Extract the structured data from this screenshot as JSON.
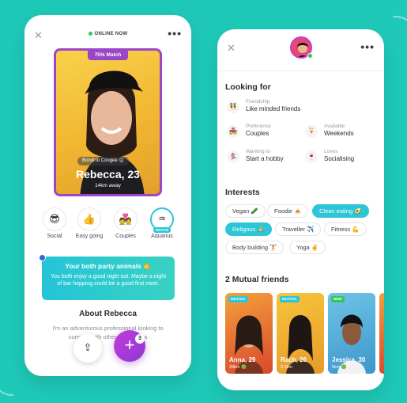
{
  "left_phone": {
    "status": "ONLINE NOW",
    "match_badge": "75% Match",
    "tag": "Bondi to Coogee 😊",
    "name_age": "Rebecca, 23",
    "distance": "14km away",
    "traits": [
      {
        "emoji": "😎",
        "label": "Social"
      },
      {
        "emoji": "👍",
        "label": "Easy going"
      },
      {
        "emoji": "💑",
        "label": "Couples"
      },
      {
        "emoji": "♒",
        "label": "Aquarius",
        "badge": "MATCH"
      }
    ],
    "party_title": "Your both party animals 🤙",
    "party_text": "You both enjoy a good night out. Maybe a night of bar hopping could be a good first meet.",
    "about_title": "About Rebecca",
    "about_text": "I'm an adventurous professional looking to connect with others who are a",
    "add_count": "3"
  },
  "right_phone": {
    "looking_for_title": "Looking for",
    "looking_for": [
      {
        "icon": "👯",
        "small": "Friendship",
        "big": "Like minded friends"
      },
      {
        "icon": "💑",
        "small": "Preference",
        "big": "Couples"
      },
      {
        "icon": "🍹",
        "small": "Available",
        "big": "Weekends"
      },
      {
        "icon": "🏂",
        "small": "Wanting to",
        "big": "Start a hobby"
      },
      {
        "icon": "🍷",
        "small": "Loves",
        "big": "Socialising"
      }
    ],
    "interests_title": "Interests",
    "interests": [
      {
        "label": "Vegan 🥒",
        "selected": false
      },
      {
        "label": "Foodie 🍝",
        "selected": false
      },
      {
        "label": "Clean eating 🥑",
        "selected": true
      },
      {
        "label": "Religous 🙏",
        "selected": true
      },
      {
        "label": "Traveller ✈️",
        "selected": false
      },
      {
        "label": "Fitness 💪",
        "selected": false
      },
      {
        "label": "Body building 🏋",
        "selected": false
      },
      {
        "label": "Yoga ✌️",
        "selected": false
      }
    ],
    "mutual_title": "2 Mutual friends",
    "friends": [
      {
        "badge": "MUTUAL",
        "name": "Anna, 29",
        "dist": "29km 🟢"
      },
      {
        "badge": "MUTUAL",
        "name": "Rach, 26",
        "dist": "2.3km"
      },
      {
        "badge": "NEW",
        "name": "Jessica, 30",
        "dist": "5km 🟢"
      }
    ]
  }
}
